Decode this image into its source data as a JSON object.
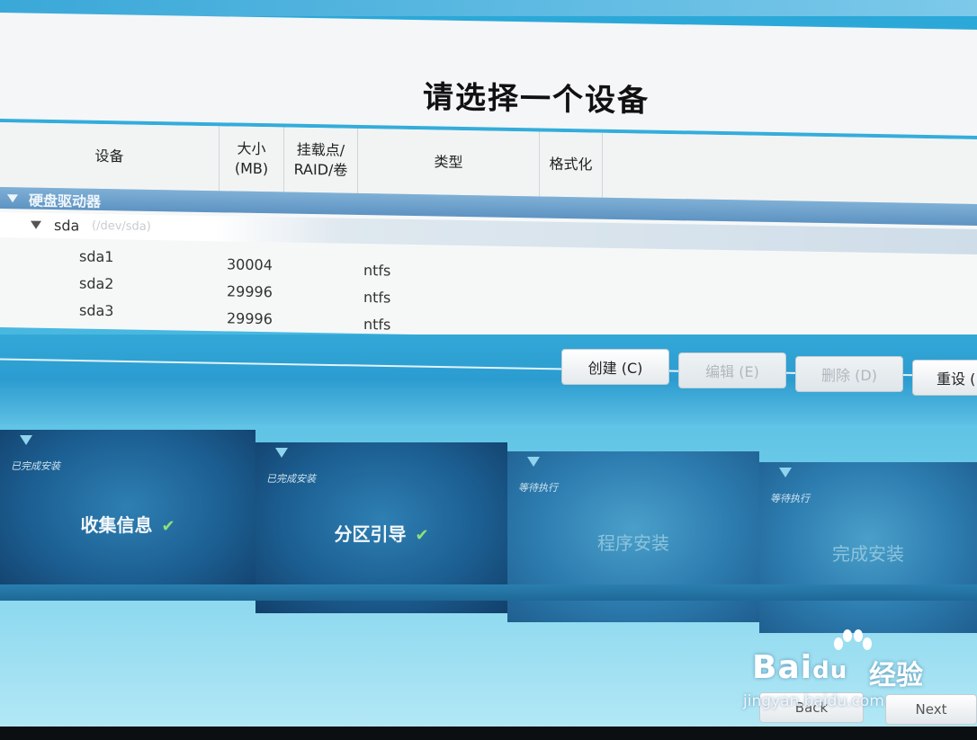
{
  "title": "请选择一个设备",
  "table": {
    "columns": {
      "device": "设备",
      "size": "大小\n(MB)",
      "mount": "挂载点/\nRAID/卷",
      "type": "类型",
      "format": "格式化"
    },
    "group": {
      "label": "硬盘驱动器"
    },
    "drive": {
      "name": "sda",
      "path": "(/dev/sda)"
    },
    "partitions": [
      {
        "name": "sda1",
        "size": "30004",
        "type": "ntfs"
      },
      {
        "name": "sda2",
        "size": "29996",
        "type": "ntfs"
      },
      {
        "name": "sda3",
        "size": "29996",
        "type": "ntfs"
      }
    ]
  },
  "toolbar": {
    "create": "创建 (C)",
    "edit": "编辑 (E)",
    "delete": "删除 (D)",
    "reset": "重设 ("
  },
  "steps": [
    {
      "status": "已完成安装",
      "name": "收集信息",
      "check": "✔"
    },
    {
      "status": "已完成安装",
      "name": "分区引导",
      "check": "✔"
    },
    {
      "status": "等待执行",
      "name": "程序安装"
    },
    {
      "status": "等待执行",
      "name": "完成安装"
    }
  ],
  "nav": {
    "back": "Back",
    "next": "Next"
  },
  "watermark": {
    "brand": "Bai",
    "brand2": "du",
    "suffix": "经验",
    "url": "jingyan.baidu.com"
  },
  "colors": {
    "accent": "#2aa7d8",
    "done_step": "#1c5f92",
    "pending_step": "#2d7cb0",
    "group_row": "#5e93c2"
  }
}
